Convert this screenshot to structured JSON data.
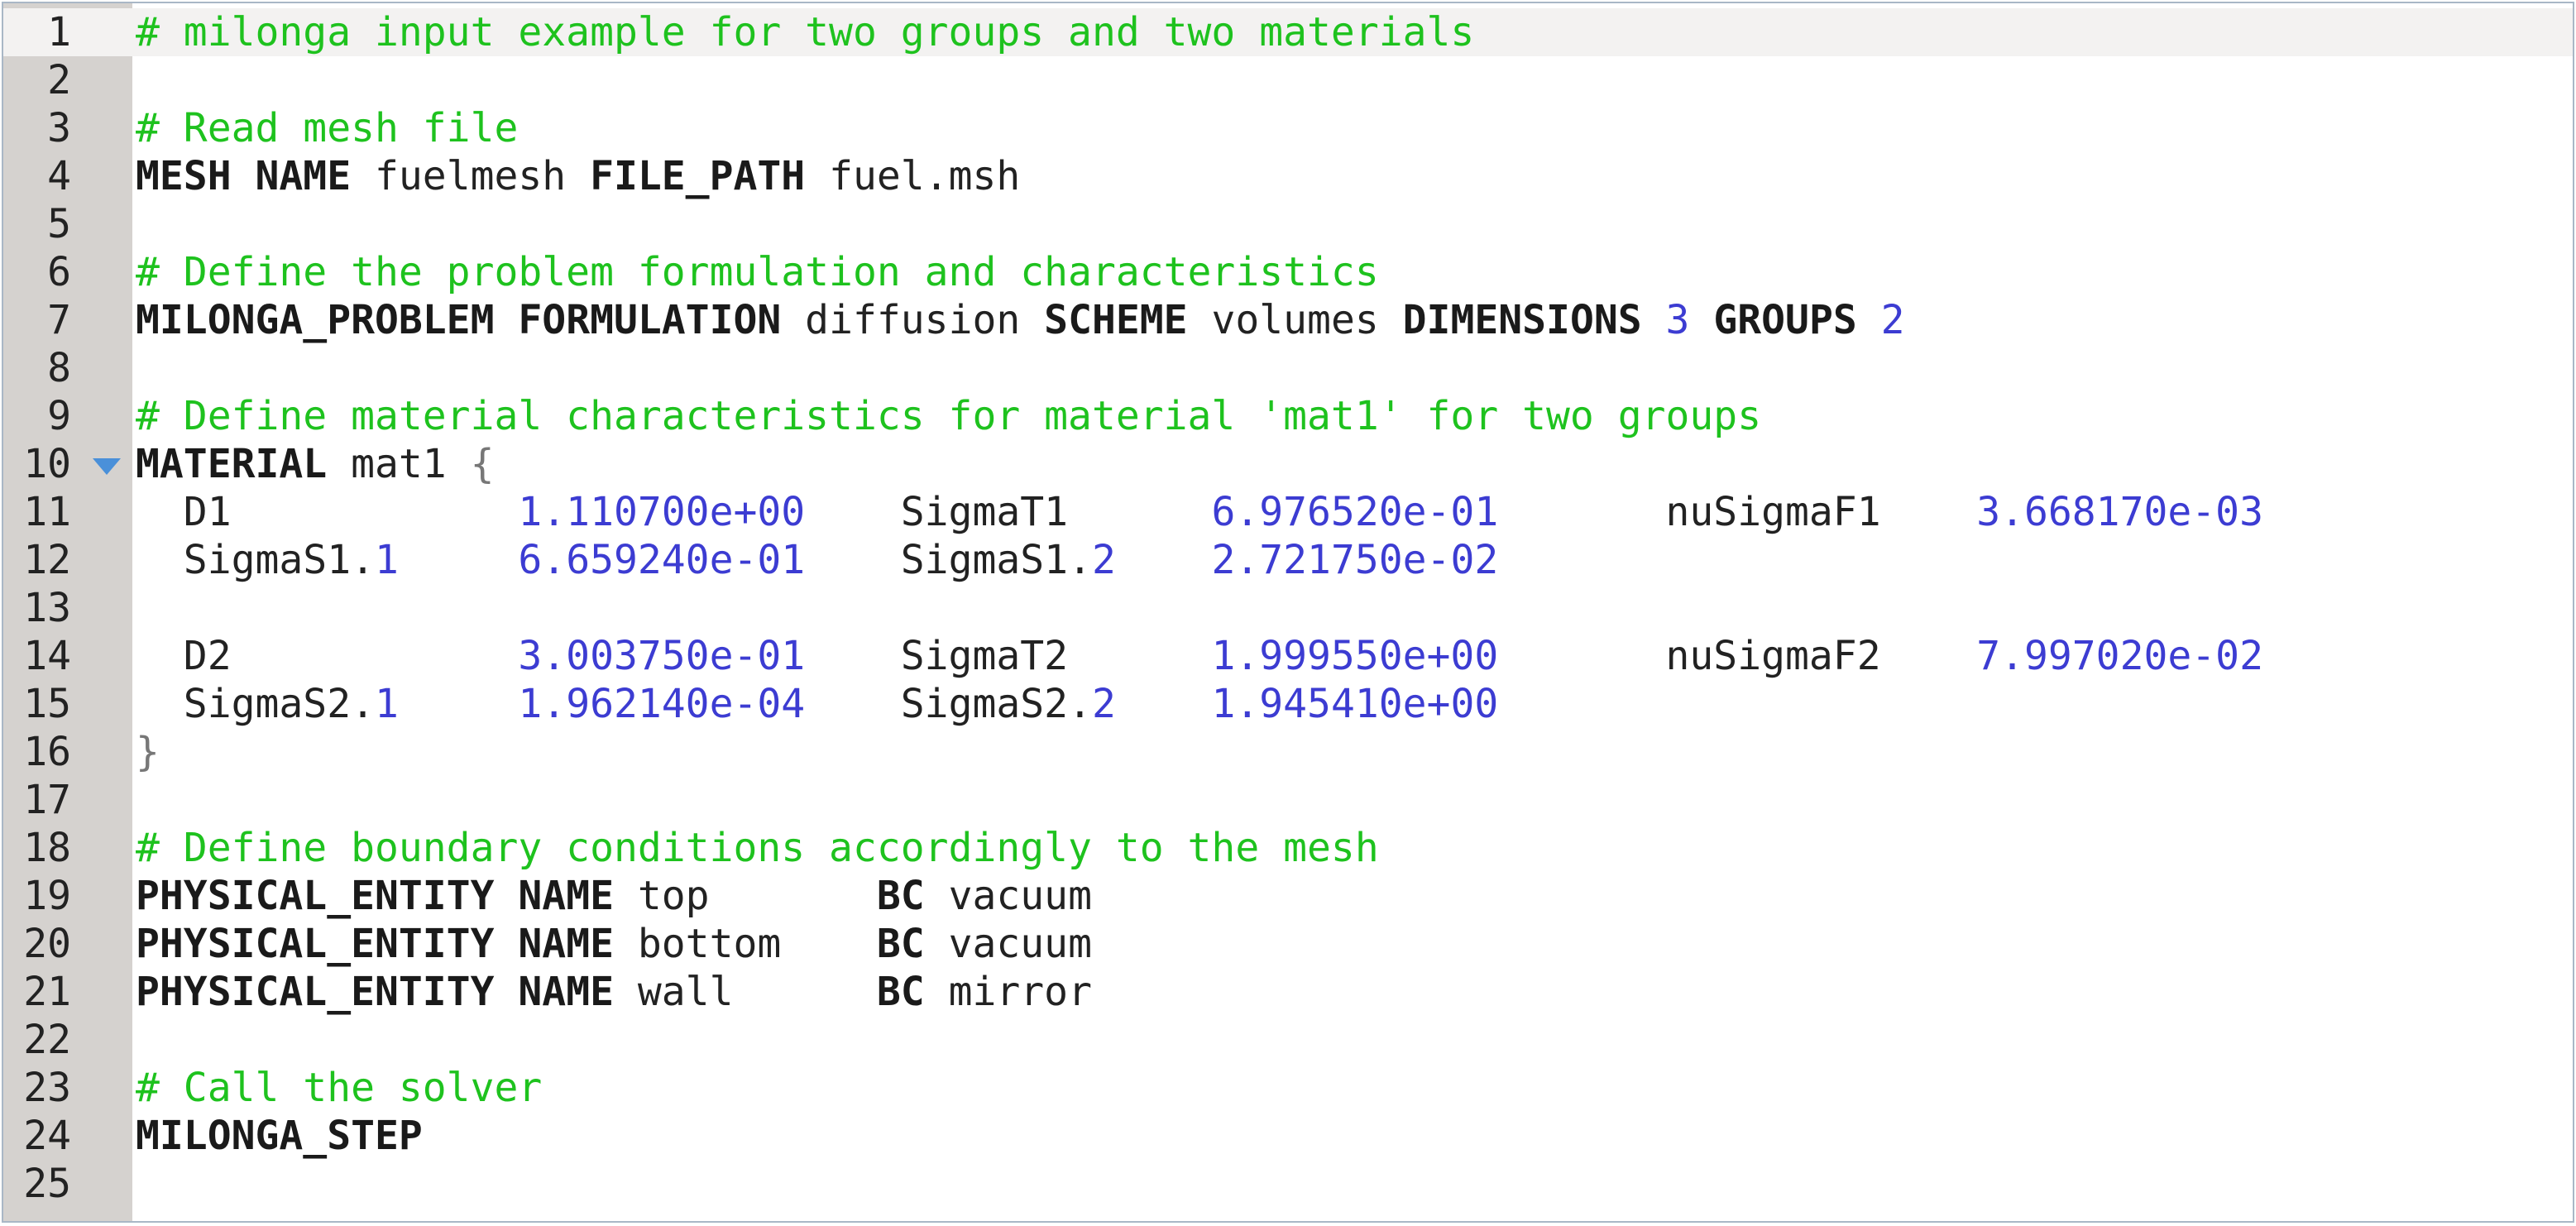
{
  "editor": {
    "language": "milonga input",
    "colors": {
      "comment": "#1ec21e",
      "number": "#3c3cd2",
      "gutter": "#d5d2cf",
      "border": "#a9b7c6"
    },
    "lines": [
      {
        "n": "1",
        "current": true,
        "tokens": [
          {
            "t": "cm",
            "v": "# milonga input example for two groups and two materials"
          }
        ]
      },
      {
        "n": "2",
        "tokens": []
      },
      {
        "n": "3",
        "tokens": [
          {
            "t": "cm",
            "v": "# Read mesh file"
          }
        ]
      },
      {
        "n": "4",
        "tokens": [
          {
            "t": "kw",
            "v": "MESH"
          },
          {
            "t": "tx",
            "v": " "
          },
          {
            "t": "kw",
            "v": "NAME"
          },
          {
            "t": "tx",
            "v": " fuelmesh "
          },
          {
            "t": "kw",
            "v": "FILE_PATH"
          },
          {
            "t": "tx",
            "v": " fuel.msh"
          }
        ]
      },
      {
        "n": "5",
        "tokens": []
      },
      {
        "n": "6",
        "tokens": [
          {
            "t": "cm",
            "v": "# Define the problem formulation and characteristics"
          }
        ]
      },
      {
        "n": "7",
        "tokens": [
          {
            "t": "kw",
            "v": "MILONGA_PROBLEM"
          },
          {
            "t": "tx",
            "v": " "
          },
          {
            "t": "kw",
            "v": "FORMULATION"
          },
          {
            "t": "tx",
            "v": " diffusion "
          },
          {
            "t": "kw",
            "v": "SCHEME"
          },
          {
            "t": "tx",
            "v": " volumes "
          },
          {
            "t": "kw",
            "v": "DIMENSIONS"
          },
          {
            "t": "tx",
            "v": " "
          },
          {
            "t": "num",
            "v": "3"
          },
          {
            "t": "tx",
            "v": " "
          },
          {
            "t": "kw",
            "v": "GROUPS"
          },
          {
            "t": "tx",
            "v": " "
          },
          {
            "t": "num",
            "v": "2"
          }
        ]
      },
      {
        "n": "8",
        "tokens": []
      },
      {
        "n": "9",
        "tokens": [
          {
            "t": "cm",
            "v": "# Define material characteristics for material 'mat1' for two groups"
          }
        ]
      },
      {
        "n": "10",
        "fold": true,
        "tokens": [
          {
            "t": "kw",
            "v": "MATERIAL"
          },
          {
            "t": "tx",
            "v": " mat1 "
          },
          {
            "t": "br",
            "v": "{"
          }
        ]
      },
      {
        "n": "11",
        "tokens": [
          {
            "t": "tx",
            "v": "  D1            "
          },
          {
            "t": "num",
            "v": "1.110700e+00"
          },
          {
            "t": "tx",
            "v": "    SigmaT1      "
          },
          {
            "t": "num",
            "v": "6.976520e-01"
          },
          {
            "t": "tx",
            "v": "       nuSigmaF1    "
          },
          {
            "t": "num",
            "v": "3.668170e-03"
          }
        ]
      },
      {
        "n": "12",
        "tokens": [
          {
            "t": "tx",
            "v": "  SigmaS1."
          },
          {
            "t": "num",
            "v": "1"
          },
          {
            "t": "tx",
            "v": "     "
          },
          {
            "t": "num",
            "v": "6.659240e-01"
          },
          {
            "t": "tx",
            "v": "    SigmaS1."
          },
          {
            "t": "num",
            "v": "2"
          },
          {
            "t": "tx",
            "v": "    "
          },
          {
            "t": "num",
            "v": "2.721750e-02"
          }
        ]
      },
      {
        "n": "13",
        "tokens": []
      },
      {
        "n": "14",
        "tokens": [
          {
            "t": "tx",
            "v": "  D2            "
          },
          {
            "t": "num",
            "v": "3.003750e-01"
          },
          {
            "t": "tx",
            "v": "    SigmaT2      "
          },
          {
            "t": "num",
            "v": "1.999550e+00"
          },
          {
            "t": "tx",
            "v": "       nuSigmaF2    "
          },
          {
            "t": "num",
            "v": "7.997020e-02"
          }
        ]
      },
      {
        "n": "15",
        "tokens": [
          {
            "t": "tx",
            "v": "  SigmaS2."
          },
          {
            "t": "num",
            "v": "1"
          },
          {
            "t": "tx",
            "v": "     "
          },
          {
            "t": "num",
            "v": "1.962140e-04"
          },
          {
            "t": "tx",
            "v": "    SigmaS2."
          },
          {
            "t": "num",
            "v": "2"
          },
          {
            "t": "tx",
            "v": "    "
          },
          {
            "t": "num",
            "v": "1.945410e+00"
          }
        ]
      },
      {
        "n": "16",
        "tokens": [
          {
            "t": "br",
            "v": "}"
          }
        ]
      },
      {
        "n": "17",
        "tokens": []
      },
      {
        "n": "18",
        "tokens": [
          {
            "t": "cm",
            "v": "# Define boundary conditions accordingly to the mesh"
          }
        ]
      },
      {
        "n": "19",
        "tokens": [
          {
            "t": "kw",
            "v": "PHYSICAL_ENTITY"
          },
          {
            "t": "tx",
            "v": " "
          },
          {
            "t": "kw",
            "v": "NAME"
          },
          {
            "t": "tx",
            "v": " top       "
          },
          {
            "t": "kw",
            "v": "BC"
          },
          {
            "t": "tx",
            "v": " vacuum"
          }
        ]
      },
      {
        "n": "20",
        "tokens": [
          {
            "t": "kw",
            "v": "PHYSICAL_ENTITY"
          },
          {
            "t": "tx",
            "v": " "
          },
          {
            "t": "kw",
            "v": "NAME"
          },
          {
            "t": "tx",
            "v": " bottom    "
          },
          {
            "t": "kw",
            "v": "BC"
          },
          {
            "t": "tx",
            "v": " vacuum"
          }
        ]
      },
      {
        "n": "21",
        "tokens": [
          {
            "t": "kw",
            "v": "PHYSICAL_ENTITY"
          },
          {
            "t": "tx",
            "v": " "
          },
          {
            "t": "kw",
            "v": "NAME"
          },
          {
            "t": "tx",
            "v": " wall      "
          },
          {
            "t": "kw",
            "v": "BC"
          },
          {
            "t": "tx",
            "v": " mirror"
          }
        ]
      },
      {
        "n": "22",
        "tokens": []
      },
      {
        "n": "23",
        "tokens": [
          {
            "t": "cm",
            "v": "# Call the solver"
          }
        ]
      },
      {
        "n": "24",
        "tokens": [
          {
            "t": "kw",
            "v": "MILONGA_STEP"
          }
        ]
      },
      {
        "n": "25",
        "tokens": []
      }
    ]
  }
}
